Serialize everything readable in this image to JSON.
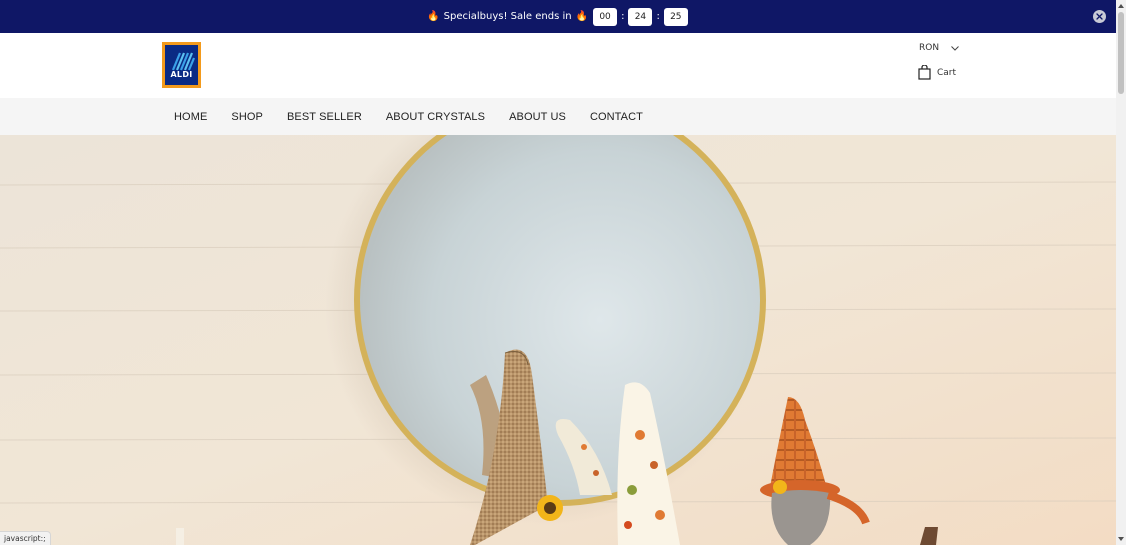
{
  "announcement": {
    "message": "Specialbuys! Sale ends in",
    "fire_icon": "🔥",
    "timer": {
      "hours": "00",
      "minutes": "24",
      "seconds": "25"
    },
    "separator": ":"
  },
  "header": {
    "logo_text": "ALDI",
    "currency": "RON",
    "cart_label": "Cart"
  },
  "nav": {
    "items": [
      "HOME",
      "SHOP",
      "BEST SELLER",
      "ABOUT CRYSTALS",
      "ABOUT US",
      "CONTACT"
    ]
  },
  "status_bar": {
    "text": "javascript:;"
  },
  "colors": {
    "announcement_bg": "#0f1766",
    "nav_bg": "#f5f5f5",
    "logo_orange": "#f39a1c",
    "logo_blue": "#0a2a84"
  }
}
